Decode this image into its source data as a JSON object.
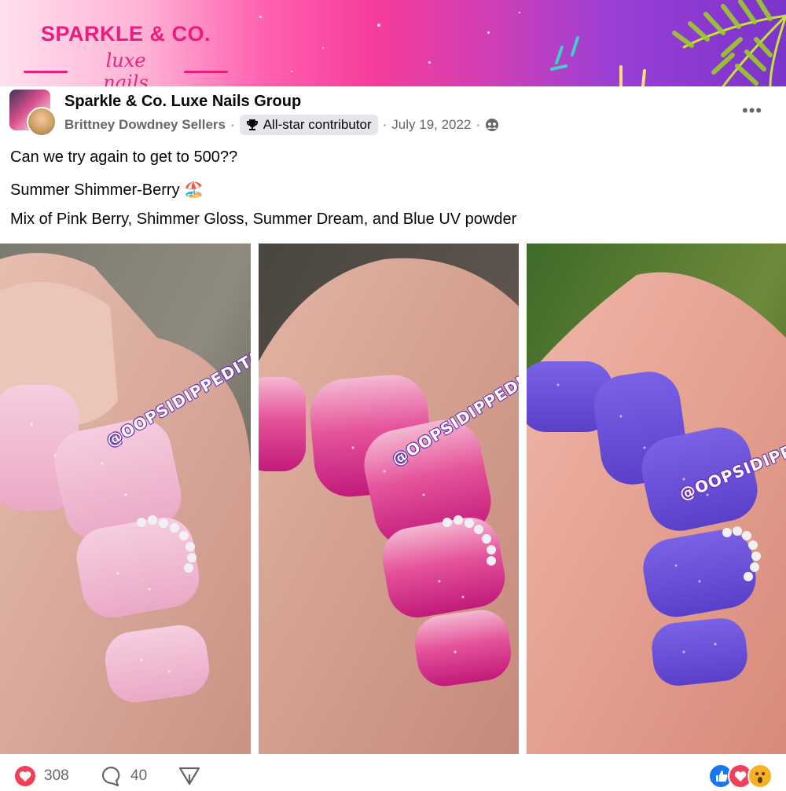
{
  "banner": {
    "brand_title": "SPARKLE & CO.",
    "brand_subtitle": "luxe nails"
  },
  "post": {
    "group_name": "Sparkle & Co. Luxe Nails Group",
    "author": "Brittney Dowdney Sellers",
    "badge": "All-star contributor",
    "date": "July 19, 2022",
    "privacy_icon": "group-members-icon",
    "more_label": "•••",
    "lines": [
      "Can we try again to get to 500??",
      "Summer Shimmer-Berry 🏖️",
      "Mix of Pink Berry, Shimmer Gloss, Summer Dream, and Blue UV powder"
    ],
    "watermark": "@OOPSIDIPPEDITAGAIN"
  },
  "footer": {
    "likes": "308",
    "comments": "40"
  },
  "colors": {
    "accent": "#ee1a7c",
    "meta": "#65676b",
    "like_blue": "#1877f2",
    "love_red": "#f33e58",
    "wow_yellow": "#f7b125"
  }
}
